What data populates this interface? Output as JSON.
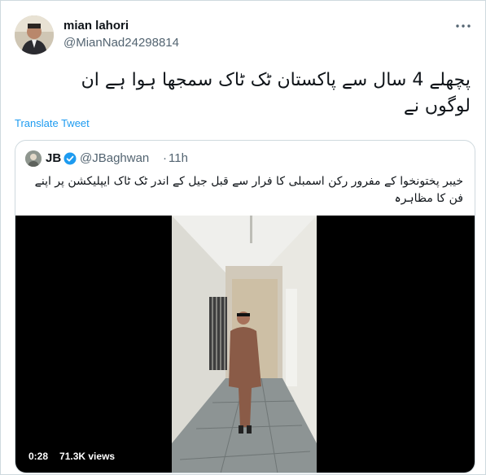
{
  "author": {
    "name": "mian lahori",
    "handle": "@MianNad24298814"
  },
  "tweet": {
    "text_line1": "پچھلے 4 سال سے پاکستان ٹک ٹاک سمجھا ہوا ہے ان",
    "text_line2": "لوگوں نے",
    "translate_label": "Translate Tweet"
  },
  "quoted": {
    "name": "JB",
    "handle": "@JBaghwan",
    "separator": "·",
    "time": "11h",
    "text": "خیبر پختونخوا کے مفرور رکن اسمبلی کا فرار سے قبل جیل کے اندر ٹک ٹاک ایپلیکشن پر اپنے فن کا مظاہرہ",
    "video": {
      "duration": "0:28",
      "views": "71.3K views"
    }
  },
  "colors": {
    "link": "#1d9bf0",
    "secondary_text": "#536471",
    "border": "#cfd9de",
    "verified": "#1d9bf0"
  },
  "icons": {
    "more": "more-dots-icon",
    "verified": "verified-badge-icon"
  }
}
